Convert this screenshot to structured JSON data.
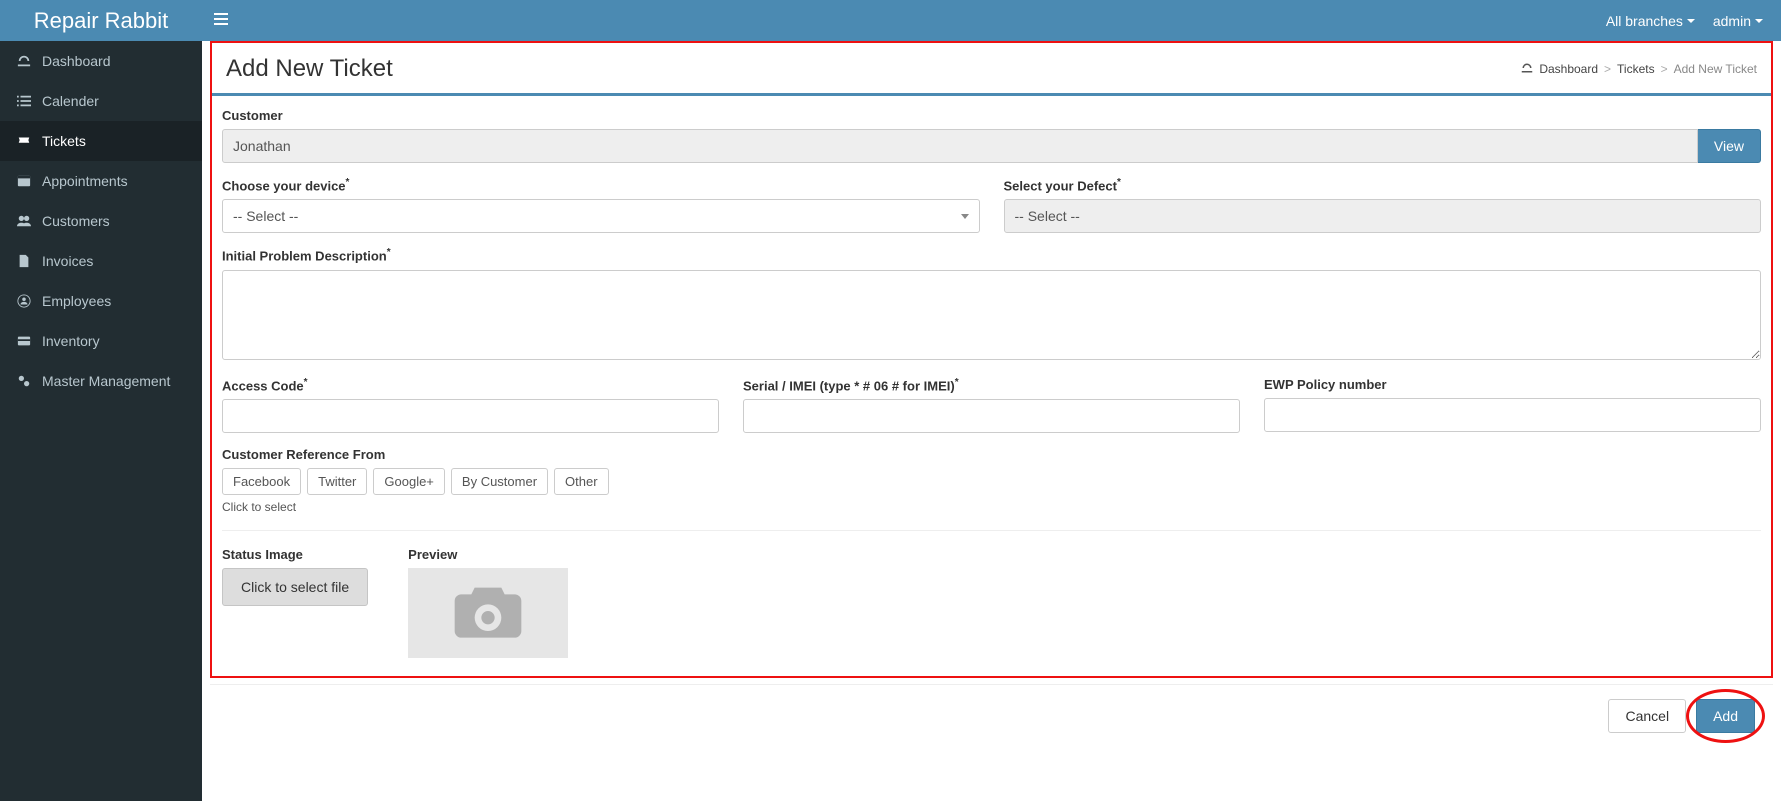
{
  "brand": "Repair Rabbit",
  "topbar": {
    "branch_label": "All branches",
    "user_label": "admin"
  },
  "sidebar": {
    "items": [
      {
        "label": "Dashboard",
        "icon": "dashboard-icon"
      },
      {
        "label": "Calender",
        "icon": "list-icon"
      },
      {
        "label": "Tickets",
        "icon": "ticket-icon",
        "active": true
      },
      {
        "label": "Appointments",
        "icon": "calendar-icon"
      },
      {
        "label": "Customers",
        "icon": "users-icon"
      },
      {
        "label": "Invoices",
        "icon": "file-icon"
      },
      {
        "label": "Employees",
        "icon": "user-circle-icon"
      },
      {
        "label": "Inventory",
        "icon": "credit-card-icon"
      },
      {
        "label": "Master Management",
        "icon": "cogs-icon"
      }
    ]
  },
  "page": {
    "title": "Add New Ticket",
    "breadcrumbs": {
      "dashboard": "Dashboard",
      "tickets": "Tickets",
      "current": "Add New Ticket"
    }
  },
  "form": {
    "customer_label": "Customer",
    "customer_value": "Jonathan",
    "view_label": "View",
    "device_label": "Choose your device",
    "device_placeholder": "-- Select --",
    "defect_label": "Select your Defect",
    "defect_placeholder": "-- Select --",
    "problem_label": "Initial Problem Description",
    "problem_value": "",
    "access_code_label": "Access Code",
    "access_code_value": "",
    "serial_label": "Serial / IMEI (type * # 06 # for IMEI)",
    "serial_value": "",
    "ewp_label": "EWP Policy number",
    "ewp_value": "",
    "ref_label": "Customer Reference From",
    "ref_options": [
      "Facebook",
      "Twitter",
      "Google+",
      "By Customer",
      "Other"
    ],
    "ref_hint": "Click to select",
    "status_image_label": "Status Image",
    "file_button_label": "Click to select file",
    "preview_label": "Preview"
  },
  "actions": {
    "cancel": "Cancel",
    "add": "Add"
  }
}
